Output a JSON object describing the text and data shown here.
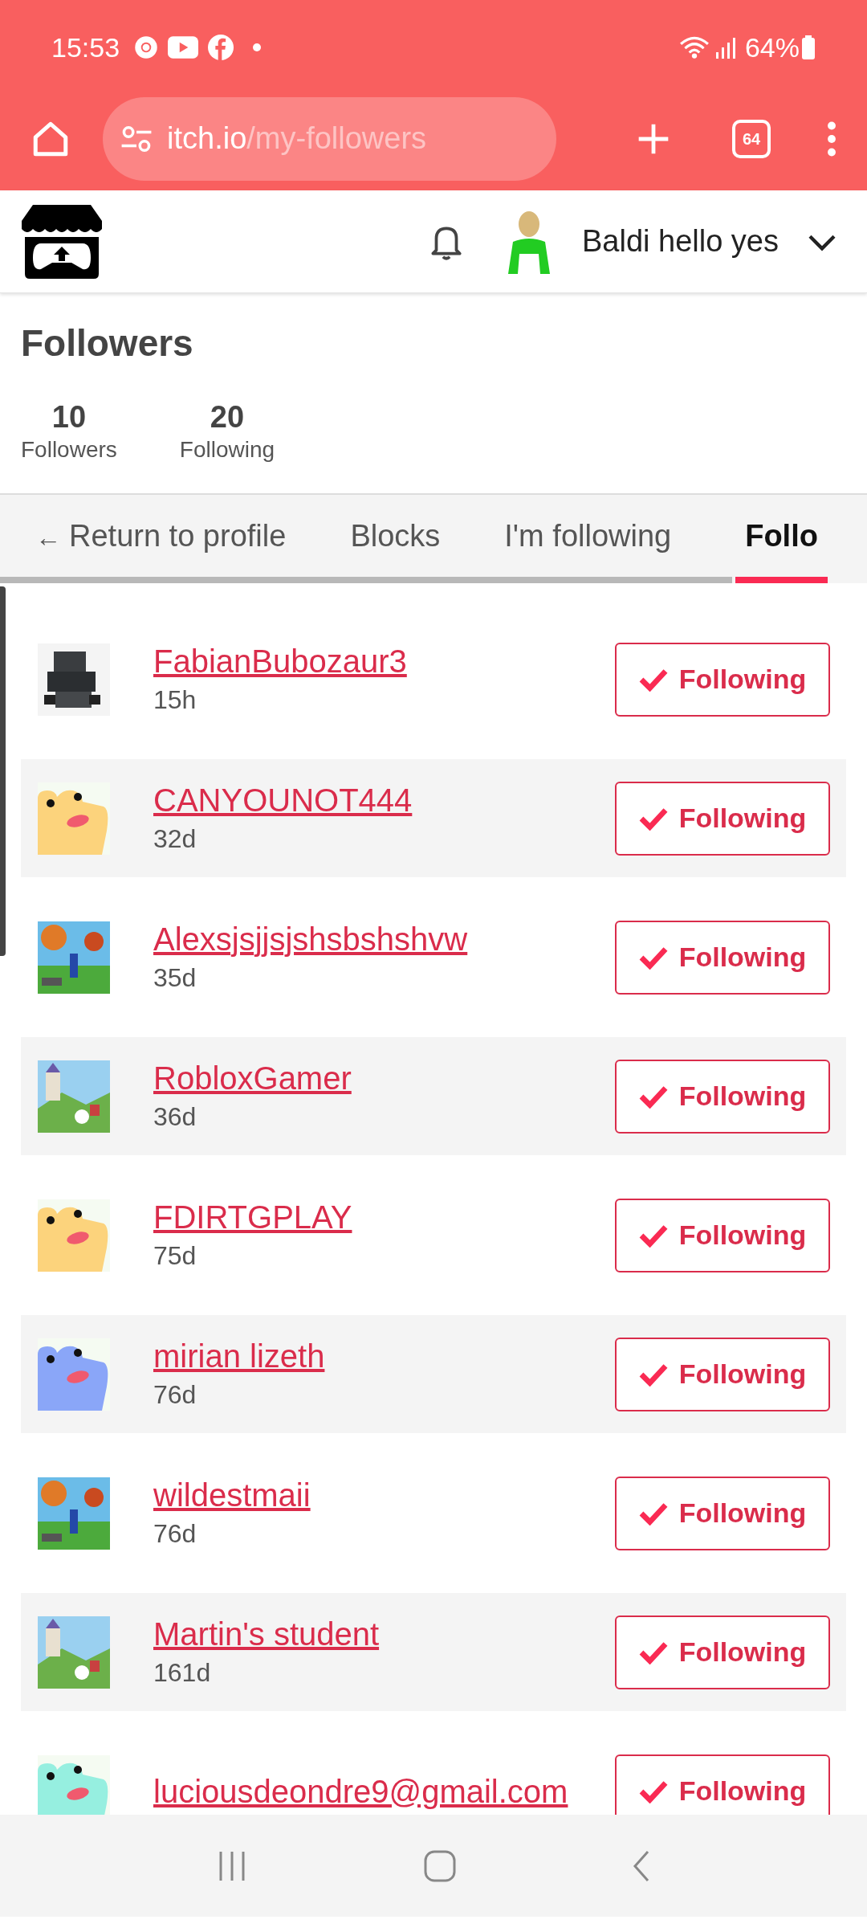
{
  "status_bar": {
    "time": "15:53",
    "battery": "64%"
  },
  "browser": {
    "url_host": "itch.io",
    "url_path": "/my-followers",
    "tab_count": "64"
  },
  "site_header": {
    "username": "Baldi hello yes"
  },
  "page": {
    "title": "Followers"
  },
  "stats": [
    {
      "value": "10",
      "label": "Followers"
    },
    {
      "value": "20",
      "label": "Following"
    }
  ],
  "tabs": [
    {
      "label": "Return to profile",
      "arrow": "←",
      "selected": false
    },
    {
      "label": "Blocks",
      "selected": false
    },
    {
      "label": "I'm following",
      "selected": false
    },
    {
      "label": "Follo",
      "selected": true
    }
  ],
  "followers": [
    {
      "name": "FabianBubozaur3",
      "time": "15h",
      "button": "Following"
    },
    {
      "name": "CANYOUNOT444",
      "time": "32d",
      "button": "Following",
      "avatar": {
        "kind": "frog",
        "color": "#fcd37c"
      }
    },
    {
      "name": "Alexsjsjjsjshsbshshvw",
      "time": "35d",
      "button": "Following"
    },
    {
      "name": "RobloxGamer",
      "time": "36d",
      "button": "Following"
    },
    {
      "name": "FDIRTGPLAY",
      "time": "75d",
      "button": "Following",
      "avatar": {
        "kind": "frog",
        "color": "#fcd37c"
      }
    },
    {
      "name": "mirian lizeth",
      "time": "76d",
      "button": "Following",
      "avatar": {
        "kind": "frog",
        "color": "#8aa6f8"
      }
    },
    {
      "name": "wildestmaii",
      "time": "76d",
      "button": "Following"
    },
    {
      "name": "Martin's student",
      "time": "161d",
      "button": "Following"
    },
    {
      "name": "luciousdeondre9@gmail.com",
      "button": "Following",
      "avatar": {
        "kind": "frog",
        "color": "#96efe0"
      }
    }
  ]
}
